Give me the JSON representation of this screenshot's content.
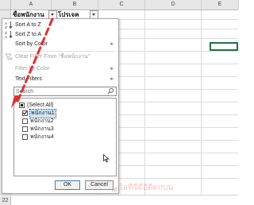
{
  "sheet": {
    "columns": [
      "A",
      "B",
      "C",
      "D",
      "E"
    ],
    "header_cells": {
      "a1": "ชื่อพนักงาน",
      "b1": "โปรเจค"
    },
    "row_label": "22"
  },
  "menu": {
    "sort_az": "Sort A to Z",
    "sort_za": "Sort Z to A",
    "sort_color": "Sort by Color",
    "clear_filter": "Clear Filter From \"ชื่อพนักงาน\"",
    "filter_color": "Filter by Color",
    "text_filters": "Text Filters",
    "search_placeholder": "Search",
    "list": [
      {
        "label": "(Select All)",
        "state": "partial"
      },
      {
        "label": "พนักงาน1",
        "state": "checked"
      },
      {
        "label": "พนักงาน2",
        "state": "unchecked"
      },
      {
        "label": "พนักงาน3",
        "state": "unchecked"
      },
      {
        "label": "พนักงาน4",
        "state": "unchecked"
      }
    ],
    "ok": "OK",
    "cancel": "Cancel"
  },
  "watermark": "ไอทีจีดีอีดีดกบน",
  "colors": {
    "accent_red": "#e0312e",
    "selection_green": "#217346"
  }
}
